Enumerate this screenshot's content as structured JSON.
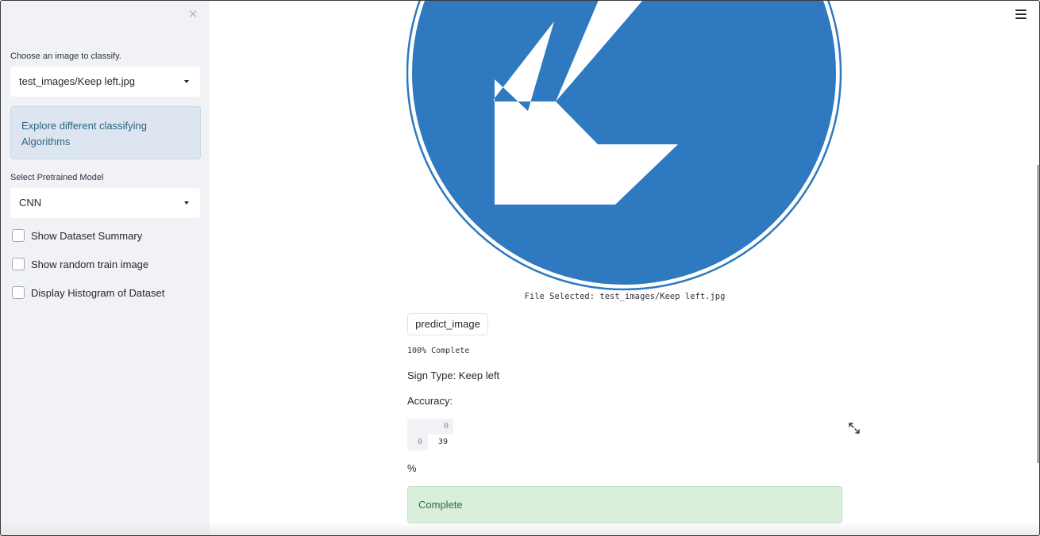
{
  "sidebar": {
    "close_glyph": "×",
    "image_select": {
      "label": "Choose an image to classify.",
      "value": "test_images/Keep left.jpg"
    },
    "info_text": "Explore different classifying Algorithms",
    "model_select": {
      "label": "Select Pretrained Model",
      "value": "CNN"
    },
    "checkboxes": [
      {
        "label": "Show Dataset Summary",
        "checked": false
      },
      {
        "label": "Show random train image",
        "checked": false
      },
      {
        "label": "Display Histogram of Dataset",
        "checked": false
      }
    ]
  },
  "main": {
    "image": {
      "icon": "keep-left-sign",
      "colors": {
        "sign_blue": "#2e79c0",
        "arrow": "#ffffff"
      }
    },
    "caption": "File Selected: test_images/Keep left.jpg",
    "predict_button": "predict_image",
    "progress_text": "100% Complete",
    "sign_type": "Sign Type: Keep left",
    "accuracy_label": "Accuracy:",
    "dataframe": {
      "column_header": "0",
      "row_index": "0",
      "value": "39"
    },
    "percent_text": "%",
    "success_text": "Complete"
  },
  "colors": {
    "sidebar_bg": "#f0f2f6",
    "info_bg": "#dde6f0",
    "info_text": "#2b6383",
    "success_bg": "#d9eedb",
    "success_text": "#2b6d3c"
  }
}
